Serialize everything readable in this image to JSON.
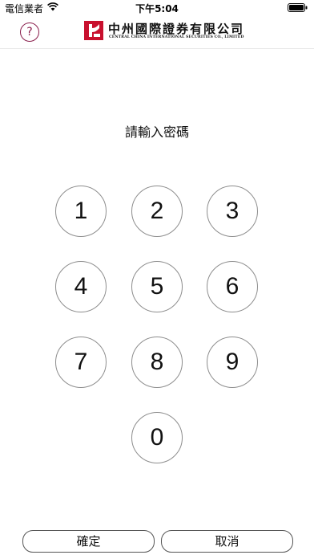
{
  "status_bar": {
    "carrier": "電信業者",
    "time": "下午5:04"
  },
  "header": {
    "help_label": "?",
    "logo_cn": "中州國際證券有限公司",
    "logo_en": "CENTRAL CHINA INTERNATIONAL SECURITIES CO., LIMITED",
    "brand_color": "#8a1f4d",
    "logo_red": "#c8102e"
  },
  "prompt": "請輸入密碼",
  "keypad": {
    "keys": [
      "1",
      "2",
      "3",
      "4",
      "5",
      "6",
      "7",
      "8",
      "9",
      "0"
    ]
  },
  "buttons": {
    "confirm_label": "確定",
    "cancel_label": "取消"
  }
}
